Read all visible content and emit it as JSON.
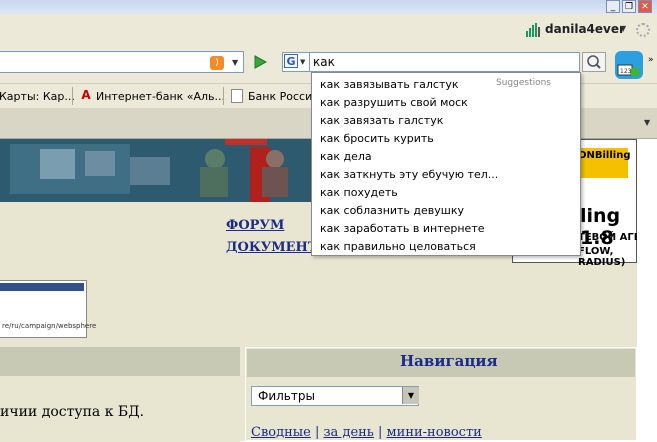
{
  "window": {
    "minimize": "_",
    "restore": "❐",
    "close": "✕"
  },
  "account": {
    "username": "danila4ever"
  },
  "search": {
    "query": "как",
    "suggestions_header": "Suggestions",
    "suggestions": [
      "как завязывать галстук",
      "как разрушить свой моск",
      "как завязать галстук",
      "как бросить курить",
      "как дела",
      "как заткнуть эту ебучую тел...",
      "как похудеть",
      "как соблазнить девушку",
      "как заработать в интернете",
      "как правильно целоваться"
    ]
  },
  "bookmarks": [
    {
      "label": "Карты: Кар..."
    },
    {
      "label": "Интернет-банк «Аль..."
    },
    {
      "label": "Банк России"
    }
  ],
  "ad": {
    "logo": "ONBilling",
    "big": "ling 1.8",
    "line1": "ТЕВОЙ АГЕНТ",
    "line2": "FLOW, RADIUS)"
  },
  "page": {
    "forum_link": "ФОРУМ",
    "docs_link": "ДОКУМЕНТА",
    "thumb_url": "re/ru/campaign/websphere",
    "content_text": "ичии доступа к БД.",
    "nav_title": "Навигация",
    "filter_value": "Фильтры",
    "nav_links": [
      "Сводные",
      "за день",
      "мини-новости"
    ]
  },
  "colors": {
    "link": "#1a2a8a",
    "panel": "#e8e6d1",
    "panel_header": "#c7c9b4",
    "banner": "#24495a"
  }
}
